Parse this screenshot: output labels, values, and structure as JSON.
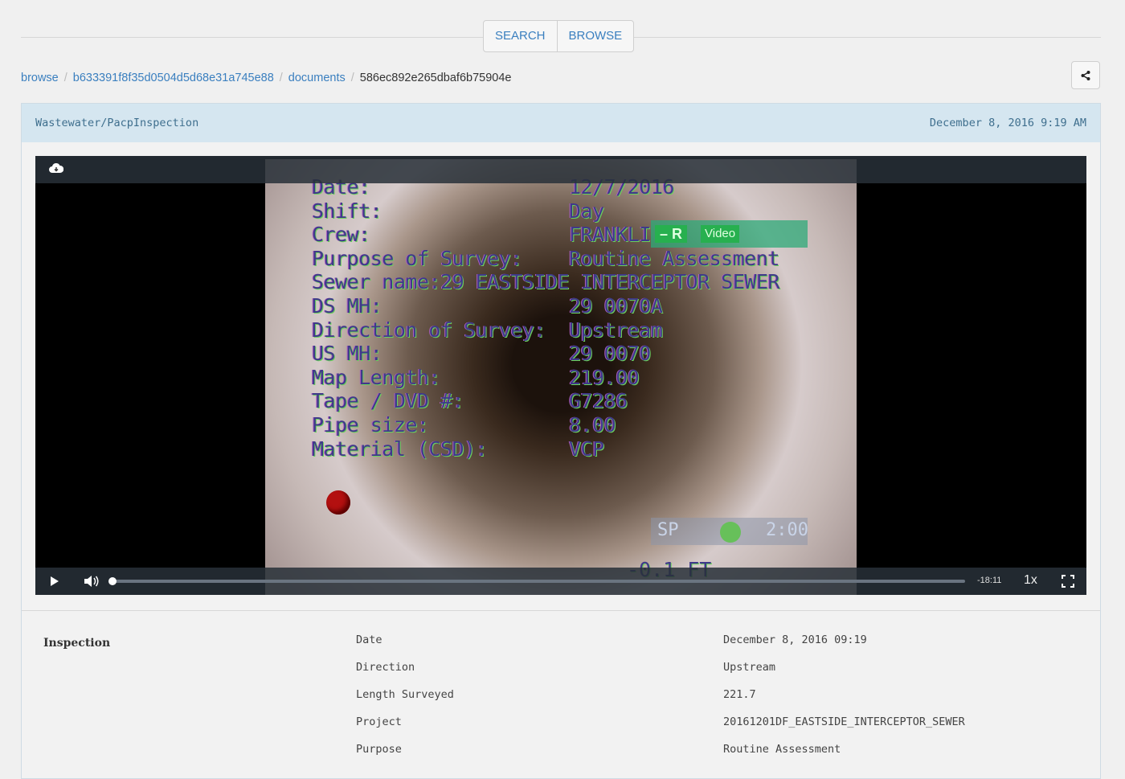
{
  "nav": {
    "tabs": [
      "SEARCH",
      "BROWSE"
    ]
  },
  "breadcrumb": {
    "items": [
      "browse",
      "b633391f8f35d0504d5d68e31a745e88",
      "documents"
    ],
    "current": "586ec892e265dbaf6b75904e"
  },
  "panel": {
    "title": "Wastewater/PacpInspection",
    "date": "December 8, 2016 9:19 AM"
  },
  "video": {
    "overlay": [
      {
        "label": "Date:",
        "value": "12/7/2016"
      },
      {
        "label": "Shift:",
        "value": "Day"
      },
      {
        "label": "Crew:",
        "value": "FRANKLI"
      },
      {
        "label": "Purpose of Survey:",
        "value": "Routine Assessment"
      },
      {
        "label": "Sewer name:29 EASTSIDE INTERCEPTOR SEWER",
        "value": ""
      },
      {
        "label": "DS MH:",
        "value": "29 0070A"
      },
      {
        "label": "Direction of Survey:",
        "value": "Upstream"
      },
      {
        "label": "US MH:",
        "value": "29 0070"
      },
      {
        "label": "Map Length:",
        "value": "219.00"
      },
      {
        "label": "Tape / DVD #:",
        "value": "G7286"
      },
      {
        "label": "Pipe size:",
        "value": "8.00"
      },
      {
        "label": "Material (CSD):",
        "value": "VCP"
      }
    ],
    "badge_r": "– R",
    "badge_video": "Video",
    "sp_label": "SP",
    "sp_time": "2:00",
    "footage": "-0.1 FT",
    "remaining_time": "-18:11",
    "speed": "1x",
    "progress": 0.0
  },
  "details": {
    "section": "Inspection",
    "rows": [
      {
        "key": "Date",
        "value": "December 8, 2016 09:19"
      },
      {
        "key": "Direction",
        "value": "Upstream"
      },
      {
        "key": "Length Surveyed",
        "value": "221.7"
      },
      {
        "key": "Project",
        "value": "20161201DF_EASTSIDE_INTERCEPTOR_SEWER"
      },
      {
        "key": "Purpose",
        "value": "Routine Assessment"
      }
    ]
  }
}
